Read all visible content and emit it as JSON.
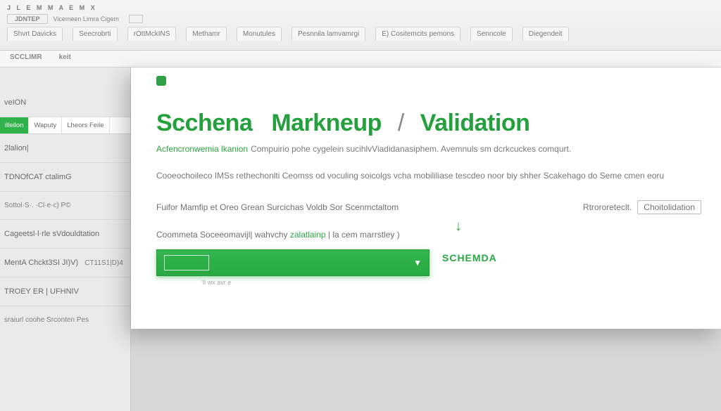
{
  "ribbon": {
    "appline": "J L E M M A  E M X",
    "tabs_pill": "JDNTEP",
    "tabs_rest": "Vicemeen Limra Cigem",
    "menu": [
      "Shvrt Davicks",
      "Seecrobrti",
      "rOttMckINS",
      "Methamr",
      "Monutules",
      "Pesnnila lamvamrgi",
      "E) Cositemcits pemons",
      "Senncole",
      "Diegendeit"
    ]
  },
  "secondbar": {
    "a": "SCCLIMR",
    "b": "keit"
  },
  "sidebar": {
    "item0": "veION",
    "subtabs": [
      "illeilon",
      "Waputy",
      "Lheors Feile"
    ],
    "item2": "2lalion|",
    "item3": "TDNOfCAT ctalimG",
    "item4": "Sottol·S·. ·Cl·e·c) P©",
    "item5": "Cageetsl·l·rle sVdouldtation",
    "item6_a": "MentA Chckt3SI JI)V)",
    "item6_b": "CT11S1|D)4",
    "item7": "TROEY ER | UFHNIV",
    "item8": "sraiurl coohe Srconten Pes"
  },
  "card": {
    "heading_a": "Scchena",
    "heading_b": "Markneup",
    "heading_sep": "/",
    "heading_c": "Validation",
    "sub_a": "Acfencronwemia lkanion",
    "sub_b": "Compuirio pohe cygelein sucihlvViadidanasiphem. Avemnuls sm dcrkcuckes comqurt.",
    "body1": "Cooeochoileco IMSs rethechonlti Ceomss od voculing soicolgs vcha mobililiase tescdeo noor biy shher Scakehago do Seme cmen eoru",
    "body2_left": "Fuifor Mamfip et Oreo Grean Surcichas Voldb Sor Scenmctaltom",
    "body2_right_a": "Rtrororeteclt.",
    "body2_right_b": "Choitolidation",
    "body3_a": "Coommeta Soceeomavijl| wahvchy",
    "body3_b": "zalatlainp",
    "body3_c": "| la cem marrstley )",
    "schema_label": "SCHEMDA",
    "tinyfoot": "'Il  wx avr e"
  }
}
